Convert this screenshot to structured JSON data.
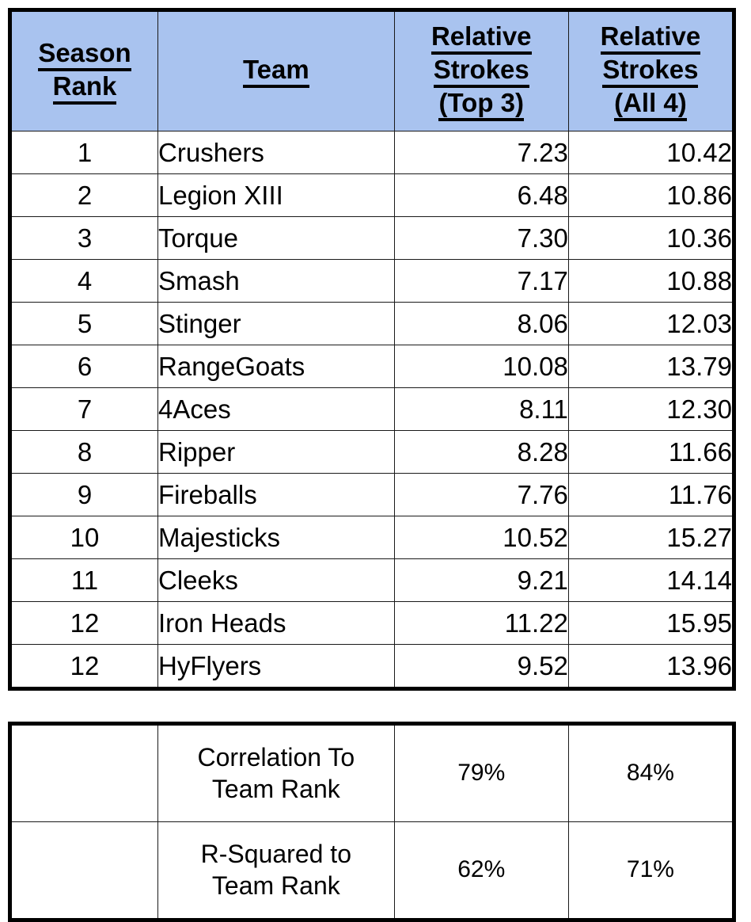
{
  "main_table": {
    "headers": [
      {
        "lines": [
          "Season",
          "Rank"
        ]
      },
      {
        "lines": [
          "Team"
        ]
      },
      {
        "lines": [
          "Relative",
          "Strokes",
          "(Top 3)"
        ]
      },
      {
        "lines": [
          "Relative",
          "Strokes",
          "(All 4)"
        ]
      }
    ],
    "rows": [
      {
        "rank": "1",
        "team": "Crushers",
        "top3": "7.23",
        "all4": "10.42"
      },
      {
        "rank": "2",
        "team": "Legion XIII",
        "top3": "6.48",
        "all4": "10.86"
      },
      {
        "rank": "3",
        "team": "Torque",
        "top3": "7.30",
        "all4": "10.36"
      },
      {
        "rank": "4",
        "team": "Smash",
        "top3": "7.17",
        "all4": "10.88"
      },
      {
        "rank": "5",
        "team": "Stinger",
        "top3": "8.06",
        "all4": "12.03"
      },
      {
        "rank": "6",
        "team": "RangeGoats",
        "top3": "10.08",
        "all4": "13.79"
      },
      {
        "rank": "7",
        "team": "4Aces",
        "top3": "8.11",
        "all4": "12.30"
      },
      {
        "rank": "8",
        "team": "Ripper",
        "top3": "8.28",
        "all4": "11.66"
      },
      {
        "rank": "9",
        "team": "Fireballs",
        "top3": "7.76",
        "all4": "11.76"
      },
      {
        "rank": "10",
        "team": "Majesticks",
        "top3": "10.52",
        "all4": "15.27"
      },
      {
        "rank": "11",
        "team": "Cleeks",
        "top3": "9.21",
        "all4": "14.14"
      },
      {
        "rank": "12",
        "team": "Iron Heads",
        "top3": "11.22",
        "all4": "15.95"
      },
      {
        "rank": "12",
        "team": "HyFlyers",
        "top3": "9.52",
        "all4": "13.96"
      }
    ]
  },
  "summary_table": {
    "rows": [
      {
        "blank": "",
        "label_line1": "Correlation To",
        "label_line2": "Team Rank",
        "top3": "79%",
        "all4": "84%"
      },
      {
        "blank": "",
        "label_line1": "R-Squared to",
        "label_line2": "Team Rank",
        "top3": "62%",
        "all4": "71%"
      }
    ]
  },
  "colors": {
    "header_background": "#a9c3ef",
    "border": "#000000",
    "grid_line": "#1a1a1a",
    "text": "#000000",
    "page_background": "#ffffff"
  }
}
